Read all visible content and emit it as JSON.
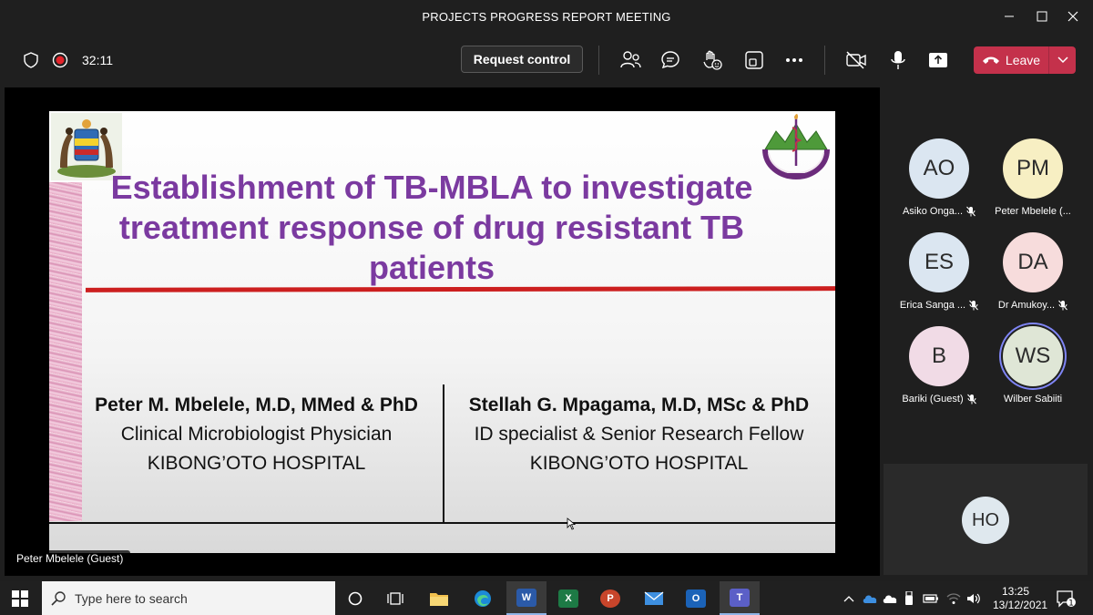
{
  "window": {
    "title": "PROJECTS PROGRESS REPORT MEETING"
  },
  "toolbar": {
    "timer": "32:11",
    "request_control": "Request control",
    "leave": "Leave"
  },
  "slide": {
    "title": "Establishment of TB-MBLA to investigate treatment response of drug resistant TB patients",
    "left": {
      "name": "Peter M. Mbelele, M.D, MMed & PhD",
      "role": "Clinical Microbiologist Physician",
      "org": "KIBONG’OTO HOSPITAL"
    },
    "right": {
      "name": "Stellah G. Mpagama, M.D, MSc & PhD",
      "role": "ID specialist & Senior Research Fellow",
      "org": "KIBONG’OTO HOSPITAL"
    },
    "colors": {
      "title": "#7b3aa0",
      "rule": "#cc1f1f"
    }
  },
  "presenter_label": "Peter Mbelele (Guest)",
  "participants": [
    {
      "initials": "AO",
      "name": "Asiko Onga...",
      "color": "#dbe6f1",
      "muted": true
    },
    {
      "initials": "PM",
      "name": "Peter Mbelele (...",
      "color": "#f7efc3",
      "muted": false
    },
    {
      "initials": "ES",
      "name": "Erica Sanga ...",
      "color": "#dbe6f1",
      "muted": true
    },
    {
      "initials": "DA",
      "name": "Dr Amukoy...",
      "color": "#f7dcdc",
      "muted": true
    },
    {
      "initials": "B",
      "name": "Bariki (Guest)",
      "color": "#f1dbe6",
      "muted": true
    },
    {
      "initials": "WS",
      "name": "Wilber Sabiiti",
      "color": "#dfe6d6",
      "muted": false,
      "speaking": true
    }
  ],
  "extra_participant": {
    "initials": "HO"
  },
  "taskbar": {
    "search_placeholder": "Type here to search",
    "time": "13:25",
    "date": "13/12/2021",
    "notifications": "1"
  }
}
